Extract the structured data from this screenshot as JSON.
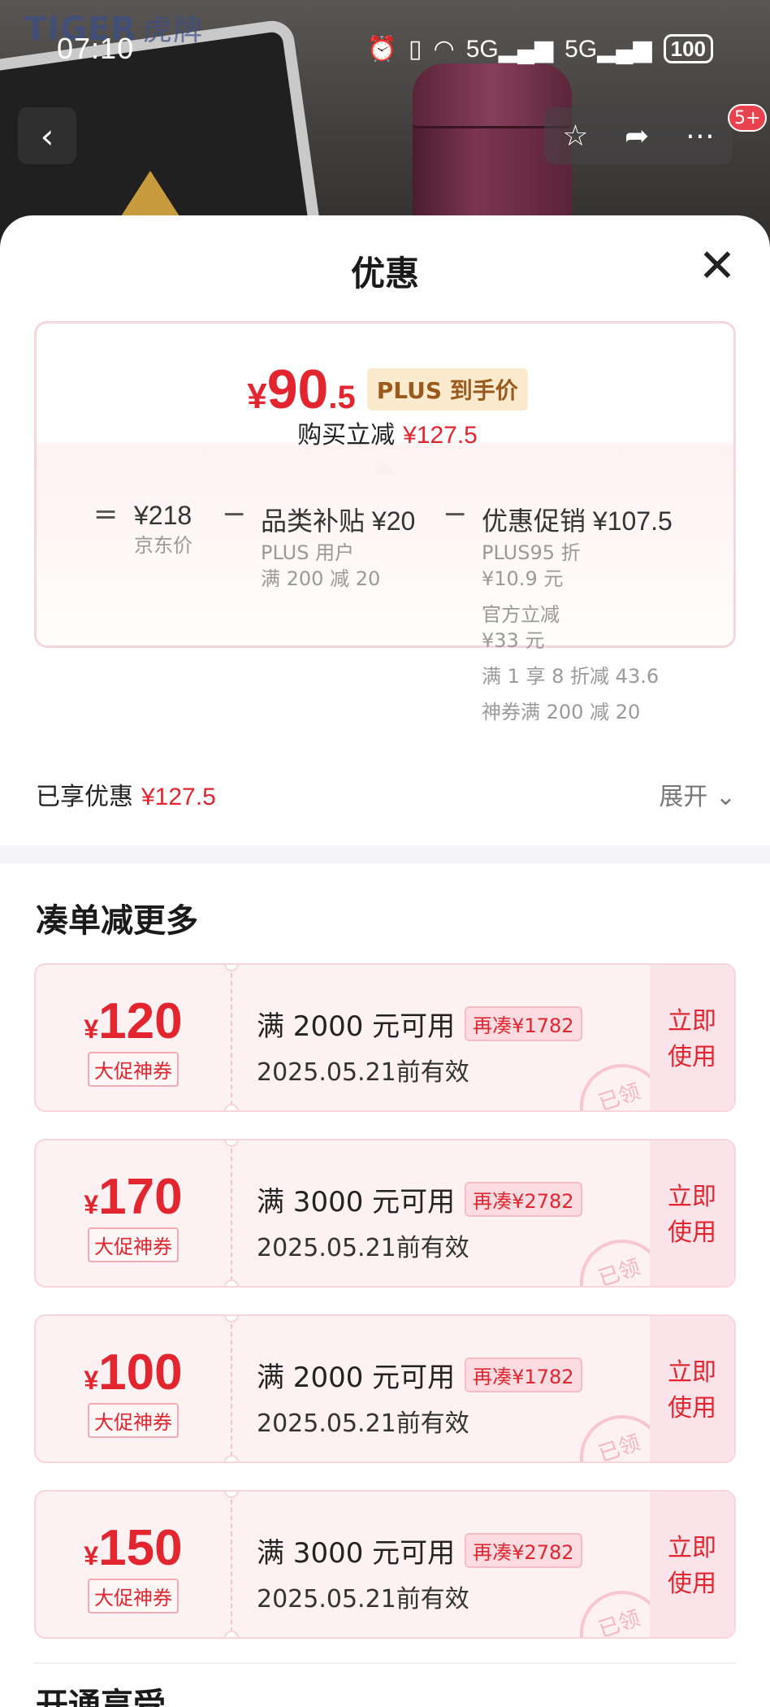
{
  "status_bar": {
    "time": "07:10",
    "network1": "5G",
    "network2": "5G",
    "battery": "100"
  },
  "background": {
    "brand_en": "TIGER",
    "brand_cn": "虎牌"
  },
  "top_actions": {
    "badge": "5+"
  },
  "sheet": {
    "title": "优惠",
    "price": {
      "currency": "¥",
      "integer": "90",
      "decimal": ".5",
      "tag": "PLUS 到手价",
      "sub_label": "购买立减",
      "sub_value": "¥127.5"
    },
    "breakdown": {
      "op_equals": "=",
      "op_minus": "−",
      "jd_price": {
        "value": "¥218",
        "label": "京东价"
      },
      "category_subsidy": {
        "value": "品类补贴 ¥20",
        "line1": "PLUS 用户",
        "line2": "满 200 减 20"
      },
      "promotion": {
        "value": "优惠促销 ¥107.5",
        "line1": "PLUS95 折",
        "line2": "¥10.9 元",
        "line3": "官方立减",
        "line4": "¥33 元",
        "line5": "满 1 享 8 折减 43.6",
        "line6": "神券满 200 减 20"
      }
    },
    "enjoyed": {
      "label": "已享优惠",
      "value": "¥127.5"
    },
    "expand": "展开",
    "section_title": "凑单减更多",
    "coupons": [
      {
        "currency": "¥",
        "amount": "120",
        "label": "大促神券",
        "condition": "满 2000 元可用",
        "tag": "再凑¥1782",
        "validity": "2025.05.21前有效",
        "action_line1": "立即",
        "action_line2": "使用",
        "stamp": "已领"
      },
      {
        "currency": "¥",
        "amount": "170",
        "label": "大促神券",
        "condition": "满 3000 元可用",
        "tag": "再凑¥2782",
        "validity": "2025.05.21前有效",
        "action_line1": "立即",
        "action_line2": "使用",
        "stamp": "已领"
      },
      {
        "currency": "¥",
        "amount": "100",
        "label": "大促神券",
        "condition": "满 2000 元可用",
        "tag": "再凑¥1782",
        "validity": "2025.05.21前有效",
        "action_line1": "立即",
        "action_line2": "使用",
        "stamp": "已领"
      },
      {
        "currency": "¥",
        "amount": "150",
        "label": "大促神券",
        "condition": "满 3000 元可用",
        "tag": "再凑¥2782",
        "validity": "2025.05.21前有效",
        "action_line1": "立即",
        "action_line2": "使用",
        "stamp": "已领"
      }
    ],
    "next_section_title": "开通享受"
  }
}
